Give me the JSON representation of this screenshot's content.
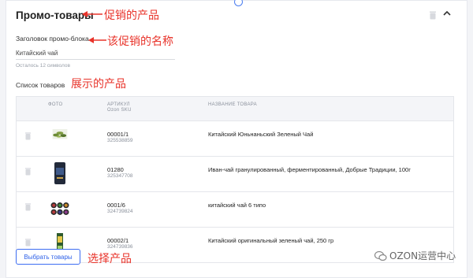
{
  "section": {
    "title": "Промо-товары"
  },
  "annotations": {
    "promo_products": "促销的产品",
    "promo_name": "该促销的名称",
    "shown_products": "展示的产品",
    "select_products": "选择产品"
  },
  "header_field": {
    "label": "Заголовок промо-блока",
    "value": "Китайский чай",
    "hint": "Осталось 12 символов"
  },
  "list": {
    "label": "Список товаров",
    "columns": {
      "photo": "ФОТО",
      "article": "АРТИКУЛ",
      "article_sub": "Ozon SKU",
      "name": "НАЗВАНИЕ ТОВАРА"
    },
    "rows": [
      {
        "article": "00001/1",
        "ozon_sku": "325538859",
        "name": "Китайский Юньнаньский Зеленый Чай",
        "image": "green-tea-leaves"
      },
      {
        "article": "01280",
        "ozon_sku": "325347708",
        "name": "Иван-чай гранулированный, ферментированный, Добрые Традиции, 100г",
        "image": "tea-package"
      },
      {
        "article": "0001/6",
        "ozon_sku": "324739824",
        "name": "китайский чай 6 типо",
        "image": "six-tea-cakes"
      },
      {
        "article": "00002/1",
        "ozon_sku": "324739836",
        "name": "Китайский оригинальный зеленый чай, 250 гр",
        "image": "tea-box"
      }
    ]
  },
  "buttons": {
    "select_products": "Выбрать товары"
  },
  "watermark": {
    "text": "OZON运营中心"
  },
  "colors": {
    "accent": "#3d6df2",
    "annotation": "#e8332a"
  }
}
